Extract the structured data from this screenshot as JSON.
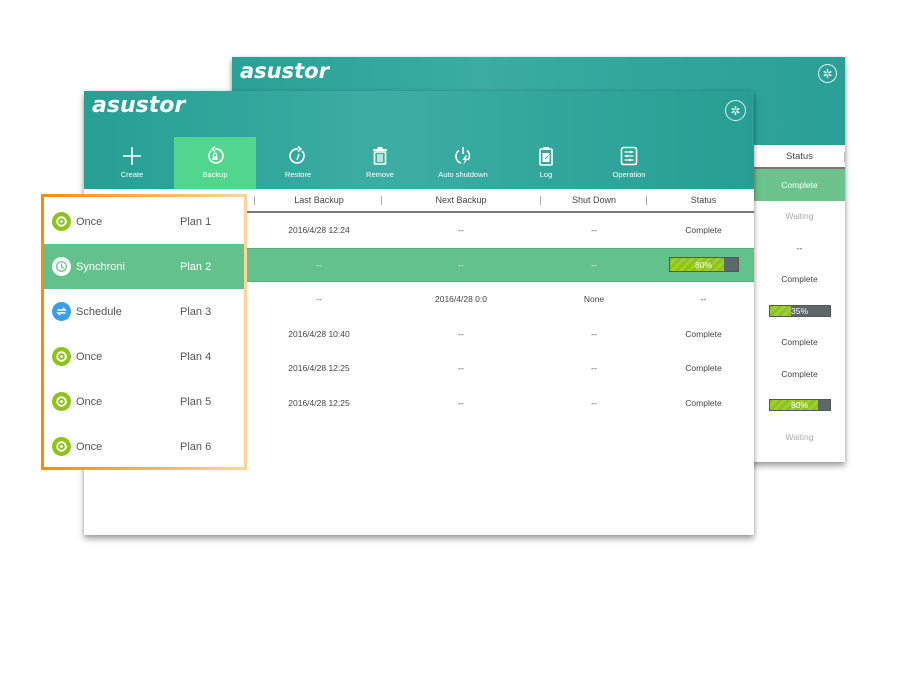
{
  "app": {
    "logo": "asustor"
  },
  "colors": {
    "header_teal": "#2aa196",
    "accent_green": "#52d68e",
    "selected_row": "#63c18b",
    "highlight_border": "#ff8c00",
    "progress_fill": "#8dc21f",
    "progress_track": "#5d6869",
    "schedule_blue": "#3a9de8",
    "once_green": "#8dc21f"
  },
  "back_window": {
    "status_header": "Status",
    "statuses": [
      {
        "text": "Complete",
        "kind": "selected"
      },
      {
        "text": "Waiting",
        "kind": "muted"
      },
      {
        "text": "--",
        "kind": "normal"
      },
      {
        "text": "Complete",
        "kind": "normal"
      },
      {
        "text": "35%",
        "kind": "progress",
        "progress": 0.35
      },
      {
        "text": "Complete",
        "kind": "normal"
      },
      {
        "text": "Complete",
        "kind": "normal"
      },
      {
        "text": "80%",
        "kind": "progress",
        "progress": 0.8
      },
      {
        "text": "Waiting",
        "kind": "muted"
      }
    ]
  },
  "toolbar": {
    "buttons": [
      {
        "label": "Create",
        "icon": "plus-icon",
        "active": false
      },
      {
        "label": "Backup",
        "icon": "backup-icon",
        "active": true
      },
      {
        "label": "Restore",
        "icon": "restore-icon",
        "active": false
      },
      {
        "label": "Remove",
        "icon": "trash-icon",
        "active": false
      },
      {
        "label": "Auto shutdown",
        "icon": "auto-shutdown-icon",
        "active": false
      },
      {
        "label": "Log",
        "icon": "log-icon",
        "active": false
      },
      {
        "label": "Operation",
        "icon": "operation-icon",
        "active": false
      }
    ]
  },
  "table": {
    "columns": [
      "Last Backup",
      "Next Backup",
      "Shut Down",
      "Status"
    ],
    "rows": [
      {
        "last": "2016/4/28 12:24",
        "next": "--",
        "shutdown": "--",
        "status": "Complete",
        "selected": false
      },
      {
        "last": "--",
        "next": "--",
        "shutdown": "--",
        "status": "80%",
        "progress": 0.8,
        "selected": true
      },
      {
        "last": "--",
        "next": "2016/4/28 0:0",
        "shutdown": "None",
        "status": "--",
        "selected": false
      },
      {
        "last": "2016/4/28 10:40",
        "next": "--",
        "shutdown": "--",
        "status": "Complete",
        "selected": false
      },
      {
        "last": "2016/4/28 12:25",
        "next": "--",
        "shutdown": "--",
        "status": "Complete",
        "selected": false
      },
      {
        "last": "2016/4/28 12:25",
        "next": "--",
        "shutdown": "--",
        "status": "Complete",
        "selected": false
      }
    ]
  },
  "plans": [
    {
      "type": "Once",
      "name": "Plan 1",
      "icon": "once-icon",
      "selected": false
    },
    {
      "type": "Synchroni",
      "name": "Plan 2",
      "icon": "sync-clock-icon",
      "selected": true
    },
    {
      "type": "Schedule",
      "name": "Plan 3",
      "icon": "schedule-icon",
      "selected": false
    },
    {
      "type": "Once",
      "name": "Plan 4",
      "icon": "once-icon",
      "selected": false
    },
    {
      "type": "Once",
      "name": "Plan 5",
      "icon": "once-icon",
      "selected": false
    },
    {
      "type": "Once",
      "name": "Plan 6",
      "icon": "once-icon",
      "selected": false
    }
  ]
}
